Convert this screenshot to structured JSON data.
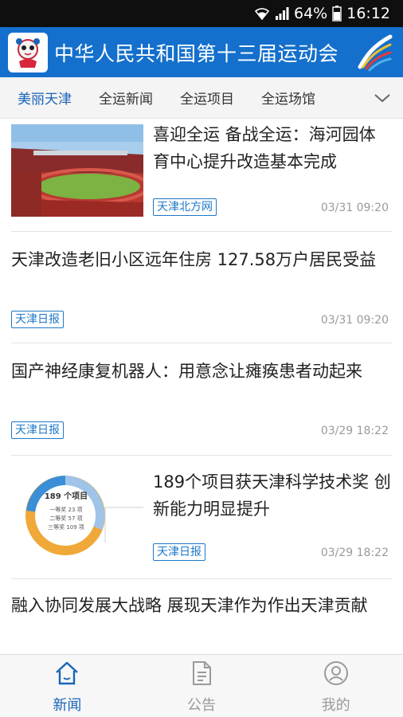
{
  "status_bar": {
    "battery": "64%",
    "time": "16:12",
    "wifi_icon": "wifi-icon",
    "signal_icon": "signal-icon",
    "battery_icon": "battery-icon"
  },
  "header": {
    "title": "中华人民共和国第十三届运动会",
    "brand_color": "#1470cc"
  },
  "tabs": [
    {
      "label": "美丽天津",
      "active": true
    },
    {
      "label": "全运新闻",
      "active": false
    },
    {
      "label": "全运项目",
      "active": false
    },
    {
      "label": "全运场馆",
      "active": false
    }
  ],
  "news": [
    {
      "title": "喜迎全运 备战全运：海河园体育中心提升改造基本完成",
      "source": "天津北方网",
      "time": "03/31 09:20"
    },
    {
      "title": "天津改造老旧小区远年住房 127.58万户居民受益",
      "source": "天津日报",
      "time": "03/31 09:20"
    },
    {
      "title": "国产神经康复机器人：用意念让瘫痪患者动起来",
      "source": "天津日报",
      "time": "03/29 18:22"
    },
    {
      "title": "189个项目获天津科学技术奖 创新能力明显提升",
      "source": "天津日报",
      "time": "03/29 18:22",
      "thumb": {
        "center": "189 个项目",
        "rows": [
          "一等奖 23 项",
          "二等奖 57 项",
          "三等奖 109 项"
        ]
      }
    },
    {
      "title": "融入协同发展大战略 展现天津作为作出天津贡献"
    }
  ],
  "bottom_nav": [
    {
      "label": "新闻",
      "icon": "home-icon",
      "active": true
    },
    {
      "label": "公告",
      "icon": "document-icon",
      "active": false
    },
    {
      "label": "我的",
      "icon": "user-icon",
      "active": false
    }
  ]
}
